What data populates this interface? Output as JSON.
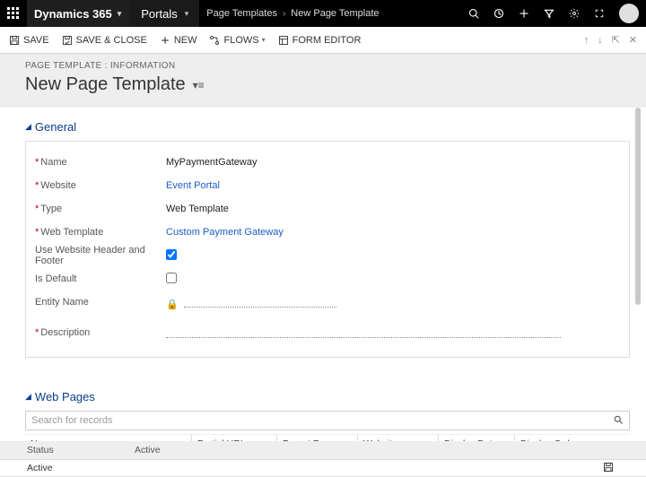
{
  "topbar": {
    "brand": "Dynamics 365",
    "area": "Portals",
    "crumb_parent": "Page Templates",
    "crumb_current": "New Page Template"
  },
  "commands": {
    "save": "SAVE",
    "save_close": "SAVE & CLOSE",
    "new": "NEW",
    "flows": "FLOWS",
    "form_editor": "FORM EDITOR"
  },
  "subheader": {
    "label": "PAGE TEMPLATE : INFORMATION",
    "title": "New Page Template"
  },
  "sections": {
    "general": "General",
    "web_pages": "Web Pages"
  },
  "form": {
    "name_label": "Name",
    "name_value": "MyPaymentGateway",
    "website_label": "Website",
    "website_value": "Event Portal",
    "type_label": "Type",
    "type_value": "Web Template",
    "webtemplate_label": "Web Template",
    "webtemplate_value": "Custom Payment Gateway",
    "usehf_label": "Use Website Header and Footer",
    "isdefault_label": "Is Default",
    "entity_label": "Entity Name",
    "description_label": "Description"
  },
  "search": {
    "placeholder": "Search for records"
  },
  "grid": {
    "col_name": "Name ↑",
    "col_partial": "Partial URL",
    "col_parent": "Parent Page",
    "col_website": "Website",
    "col_ddate": "Display Date",
    "col_dorder": "Display Order"
  },
  "status": {
    "label": "Status",
    "value": "Active",
    "active": "Active"
  }
}
